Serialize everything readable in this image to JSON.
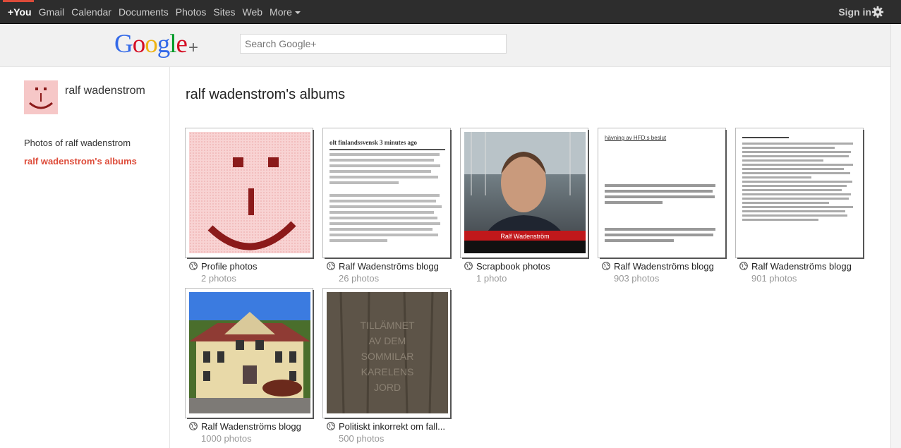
{
  "topbar": {
    "links": [
      "+You",
      "Gmail",
      "Calendar",
      "Documents",
      "Photos",
      "Sites",
      "Web",
      "More"
    ],
    "signin": "Sign in"
  },
  "header": {
    "logo": "Google",
    "logo_plus": "+",
    "search_placeholder": "Search Google+"
  },
  "profile": {
    "name": "ralf wadenstrom",
    "nav_photos": "Photos of ralf wadenstrom",
    "nav_albums": "ralf wadenstrom's albums"
  },
  "main": {
    "title": "ralf wadenstrom's albums",
    "albums": [
      {
        "title": "Profile photos",
        "count": "2 photos"
      },
      {
        "title": "Ralf Wadenströms blogg",
        "count": "26 photos",
        "thumb_text": "olt finlandssvensk 3 minutes ago"
      },
      {
        "title": "Scrapbook photos",
        "count": "1 photo",
        "thumb_text": "Ralf Wadenström"
      },
      {
        "title": "Ralf Wadenströms blogg",
        "count": "903 photos",
        "thumb_text": "hävning av HFD:s beslut"
      },
      {
        "title": "Ralf Wadenströms blogg",
        "count": "901 photos"
      },
      {
        "title": "Ralf Wadenströms blogg",
        "count": "1000 photos"
      },
      {
        "title": "Politiskt inkorrekt om fall...",
        "count": "500 photos",
        "thumb_text": "TILLÄMNET AV DEM SOMMILAR KARELENS JORD"
      }
    ]
  },
  "colors": {
    "accent": "#dd4b39",
    "topbar": "#2d2d2d"
  }
}
